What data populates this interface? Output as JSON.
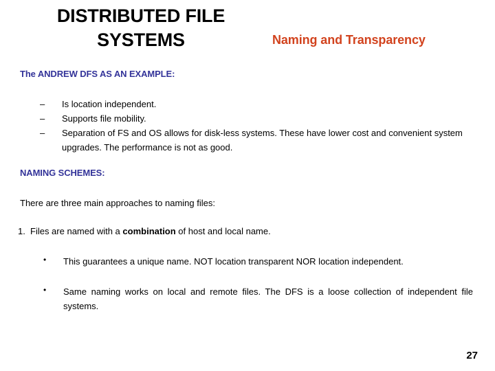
{
  "slide": {
    "title": "DISTRIBUTED FILE SYSTEMS",
    "subtitle": "Naming and Transparency",
    "page_number": "27",
    "colors": {
      "title": "#000000",
      "subtitle": "#D2431E",
      "heading": "#333399",
      "body": "#000000",
      "background": "#FFFFFF"
    }
  },
  "sections": {
    "andrew": {
      "heading": "The ANDREW DFS AS AN EXAMPLE:",
      "bullet_mark": "–",
      "items": [
        "Is location independent.",
        "Supports file mobility.",
        "Separation of FS and OS allows for disk-less systems. These have lower cost and convenient system upgrades. The performance is not as good."
      ]
    },
    "naming": {
      "heading": "NAMING SCHEMES:",
      "intro": "There are three main approaches to naming files:",
      "item_number": "1.",
      "item_text_before_bold": "Files are named with a ",
      "item_bold": "combination",
      "item_text_after_bold": " of host and local name.",
      "bullet_mark": "•",
      "sub_items": [
        "This guarantees a unique name. NOT location transparent NOR location independent.",
        "Same naming works on local and remote files. The DFS is a loose collection of independent file systems."
      ]
    }
  }
}
